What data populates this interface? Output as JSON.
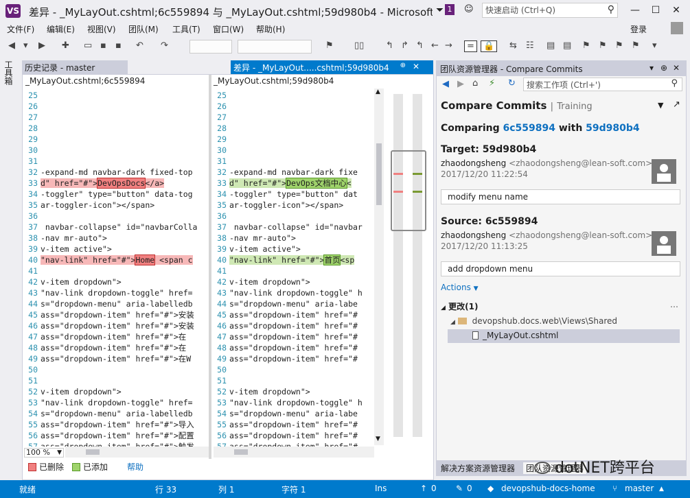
{
  "window": {
    "title": "差异 - _MyLayOut.cshtml;6c559894 与 _MyLayOut.cshtml;59d980b4 - Microsoft...",
    "notification_count": "1",
    "quick_launch_placeholder": "快速启动 (Ctrl+Q)",
    "min": "—",
    "max": "☐",
    "close": "✕"
  },
  "menu": [
    "文件(F)",
    "编辑(E)",
    "视图(V)",
    "团队(M)",
    "工具(T)",
    "窗口(W)",
    "帮助(H)"
  ],
  "login_label": "登录",
  "toolstrip_label": "工具箱",
  "tabs": {
    "history": "历史记录 - master",
    "diff": "差异 - _MyLayOut.....cshtml;59d980b4"
  },
  "diff": {
    "left_header": "_MyLayOut.cshtml;6c559894",
    "right_header": "_MyLayOut.cshtml;59d980b4",
    "left_lines": [
      {
        "n": "25",
        "t": ""
      },
      {
        "n": "26",
        "t": ""
      },
      {
        "n": "27",
        "t": ""
      },
      {
        "n": "28",
        "t": ""
      },
      {
        "n": "29",
        "t": ""
      },
      {
        "n": "30",
        "t": ""
      },
      {
        "n": "31",
        "t": ""
      },
      {
        "n": "32",
        "t": "-expand-md navbar-dark fixed-top"
      },
      {
        "n": "33",
        "pre": "d\" href=\"#\">",
        "w": "DevOpsDocs",
        "post": "</a>",
        "s": "del"
      },
      {
        "n": "34",
        "t": "-toggler\" type=\"button\" data-tog"
      },
      {
        "n": "35",
        "t": "ar-toggler-icon\"></span>"
      },
      {
        "n": "36",
        "t": ""
      },
      {
        "n": "37",
        "t": " navbar-collapse\" id=\"navbarColla"
      },
      {
        "n": "38",
        "t": "-nav mr-auto\">"
      },
      {
        "n": "39",
        "t": "v-item active\">"
      },
      {
        "n": "40",
        "pre": "\"nav-link\" href=\"#\">",
        "w": "Home",
        "post": " <span c",
        "s": "del"
      },
      {
        "n": "41",
        "t": ""
      },
      {
        "n": "42",
        "t": "v-item dropdown\">"
      },
      {
        "n": "43",
        "t": "\"nav-link dropdown-toggle\" href="
      },
      {
        "n": "44",
        "t": "s=\"dropdown-menu\" aria-labelledb"
      },
      {
        "n": "45",
        "t": "ass=\"dropdown-item\" href=\"#\">安装"
      },
      {
        "n": "46",
        "t": "ass=\"dropdown-item\" href=\"#\">安装"
      },
      {
        "n": "47",
        "t": "ass=\"dropdown-item\" href=\"#\">在"
      },
      {
        "n": "48",
        "t": "ass=\"dropdown-item\" href=\"#\">在"
      },
      {
        "n": "49",
        "t": "ass=\"dropdown-item\" href=\"#\">在W"
      },
      {
        "n": "50",
        "t": ""
      },
      {
        "n": "51",
        "t": ""
      },
      {
        "n": "52",
        "t": "v-item dropdown\">"
      },
      {
        "n": "53",
        "t": "\"nav-link dropdown-toggle\" href="
      },
      {
        "n": "54",
        "t": "s=\"dropdown-menu\" aria-labelledb"
      },
      {
        "n": "55",
        "t": "ass=\"dropdown-item\" href=\"#\">导入"
      },
      {
        "n": "56",
        "t": "ass=\"dropdown-item\" href=\"#\">配置"
      },
      {
        "n": "57",
        "t": "ass=\"dropdown-item\" href=\"#\">触发"
      }
    ],
    "right_lines": [
      {
        "n": "25",
        "t": ""
      },
      {
        "n": "26",
        "t": ""
      },
      {
        "n": "27",
        "t": ""
      },
      {
        "n": "28",
        "t": ""
      },
      {
        "n": "29",
        "t": ""
      },
      {
        "n": "30",
        "t": ""
      },
      {
        "n": "31",
        "t": ""
      },
      {
        "n": "32",
        "t": "-expand-md navbar-dark fixe"
      },
      {
        "n": "33",
        "pre": "d\" href=\"#\">",
        "w": "DevOps文档中心",
        "post": "<",
        "s": "add"
      },
      {
        "n": "34",
        "t": "-toggler\" type=\"button\" dat"
      },
      {
        "n": "35",
        "t": "ar-toggler-icon\"></span>"
      },
      {
        "n": "36",
        "t": ""
      },
      {
        "n": "37",
        "t": " navbar-collapse\" id=\"navbar"
      },
      {
        "n": "38",
        "t": "-nav mr-auto\">"
      },
      {
        "n": "39",
        "t": "v-item active\">"
      },
      {
        "n": "40",
        "pre": "\"nav-link\" href=\"#\">",
        "w": "首页",
        "post": "<sp",
        "s": "add"
      },
      {
        "n": "41",
        "t": ""
      },
      {
        "n": "42",
        "t": "v-item dropdown\">"
      },
      {
        "n": "43",
        "t": "\"nav-link dropdown-toggle\" h"
      },
      {
        "n": "44",
        "t": "s=\"dropdown-menu\" aria-labe"
      },
      {
        "n": "45",
        "t": "ass=\"dropdown-item\" href=\"#"
      },
      {
        "n": "46",
        "t": "ass=\"dropdown-item\" href=\"#"
      },
      {
        "n": "47",
        "t": "ass=\"dropdown-item\" href=\"#"
      },
      {
        "n": "48",
        "t": "ass=\"dropdown-item\" href=\"#"
      },
      {
        "n": "49",
        "t": "ass=\"dropdown-item\" href=\"#"
      },
      {
        "n": "50",
        "t": ""
      },
      {
        "n": "51",
        "t": ""
      },
      {
        "n": "52",
        "t": "v-item dropdown\">"
      },
      {
        "n": "53",
        "t": "\"nav-link dropdown-toggle\" h"
      },
      {
        "n": "54",
        "t": "s=\"dropdown-menu\" aria-labe"
      },
      {
        "n": "55",
        "t": "ass=\"dropdown-item\" href=\"#"
      },
      {
        "n": "56",
        "t": "ass=\"dropdown-item\" href=\"#"
      },
      {
        "n": "57",
        "t": "ass=\"dropdown-item\" href=\"#"
      }
    ],
    "zoom": "100 %",
    "legend": {
      "deleted": "已删除",
      "added": "已添加",
      "help": "帮助"
    },
    "colors": {
      "deleted": "#f08080",
      "added": "#9fd36b"
    }
  },
  "team_explorer": {
    "header": "团队资源管理器 - Compare Commits",
    "search_placeholder": "搜索工作项 (Ctrl+')",
    "title": "Compare Commits",
    "separator": "|",
    "subtitle": "Training",
    "comparing_prefix": "Comparing",
    "commit_a": "6c559894",
    "with": "with",
    "commit_b": "59d980b4",
    "target": {
      "label": "Target: 59d980b4",
      "author": "zhaodongsheng",
      "email": "<zhaodongsheng@lean-soft.com>",
      "date": "2017/12/20 11:22:54",
      "message": "modify menu name"
    },
    "source": {
      "label": "Source: 6c559894",
      "author": "zhaodongsheng",
      "email": "<zhaodongsheng@lean-soft.com>",
      "date": "2017/12/20 11:13:25",
      "message": "add dropdown menu"
    },
    "actions": "Actions",
    "changes": "更改(1)",
    "folder": "devopshub.docs.web\\Views\\Shared",
    "file": "_MyLayOut.cshtml",
    "bottom_tabs": [
      "解决方案资源管理器",
      "团队资源管理器"
    ]
  },
  "status": {
    "ready": "就绪",
    "row": "行 33",
    "col": "列 1",
    "char": "字符 1",
    "ins": "Ins",
    "up_count": "0",
    "pencil_count": "0",
    "repo": "devopshub-docs-home",
    "branch": "master"
  },
  "watermark": "dotNET跨平台"
}
